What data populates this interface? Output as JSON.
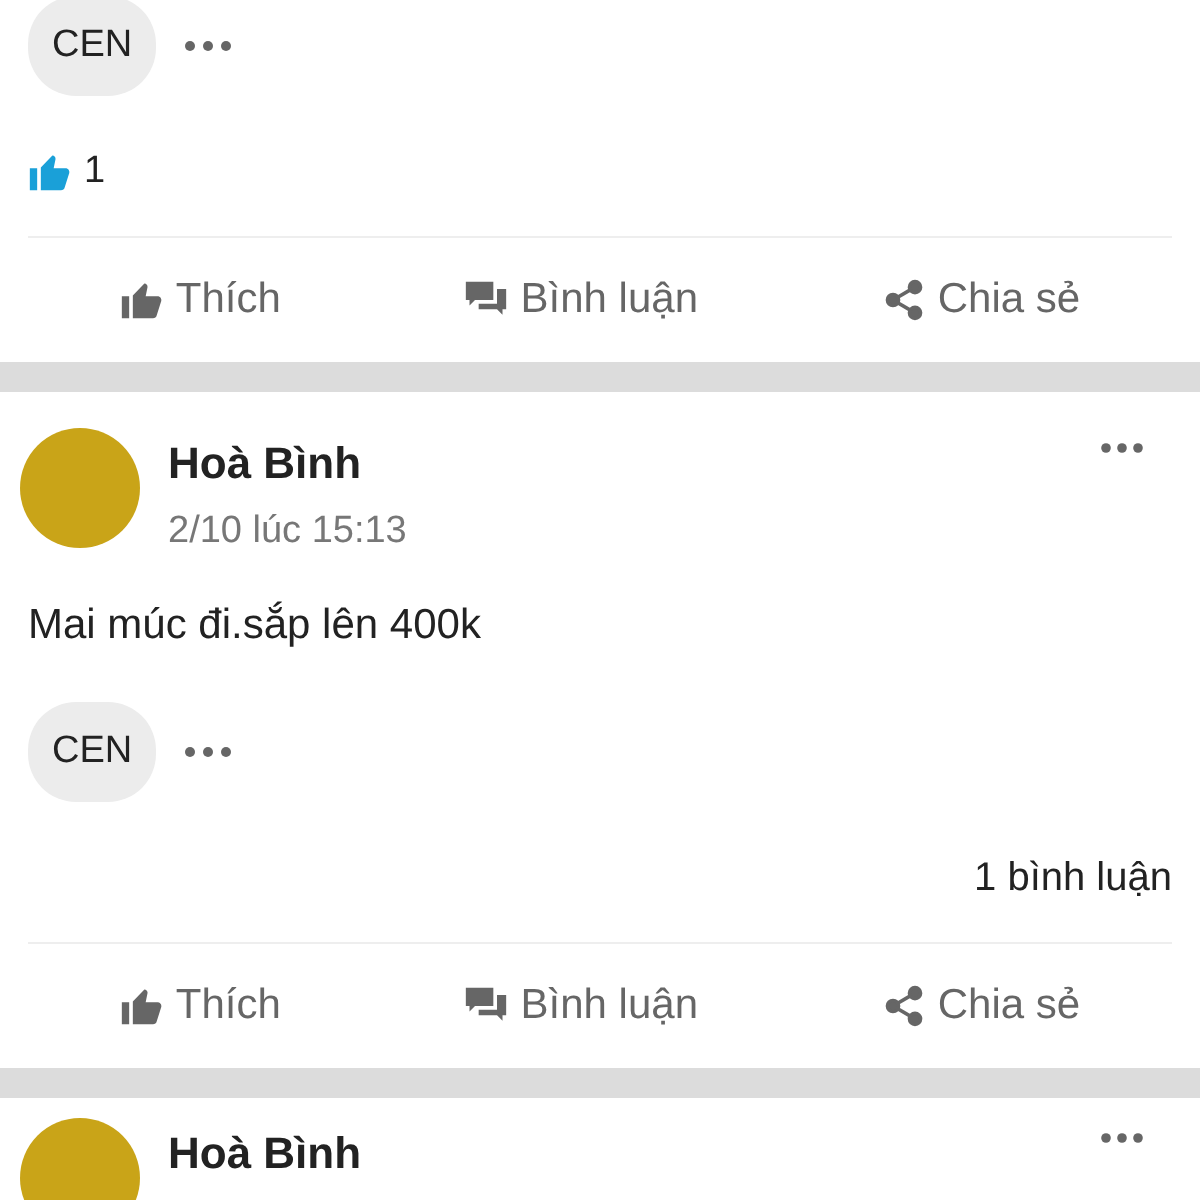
{
  "posts": [
    {
      "tags": [
        "CEN"
      ],
      "likes": "1",
      "actions": [
        {
          "kind": "like",
          "label": "Thích"
        },
        {
          "kind": "comment",
          "label": "Bình luận"
        },
        {
          "kind": "share",
          "label": "Chia sẻ"
        }
      ]
    },
    {
      "author": "Hoà Bình",
      "time": "2/10 lúc 15:13",
      "text": "Mai múc đi.sắp lên 400k",
      "tags": [
        "CEN"
      ],
      "comments": "1 bình luận",
      "actions": [
        {
          "kind": "like",
          "label": "Thích"
        },
        {
          "kind": "comment",
          "label": "Bình luận"
        },
        {
          "kind": "share",
          "label": "Chia sẻ"
        }
      ]
    },
    {
      "author": "Hoà Bình"
    }
  ]
}
